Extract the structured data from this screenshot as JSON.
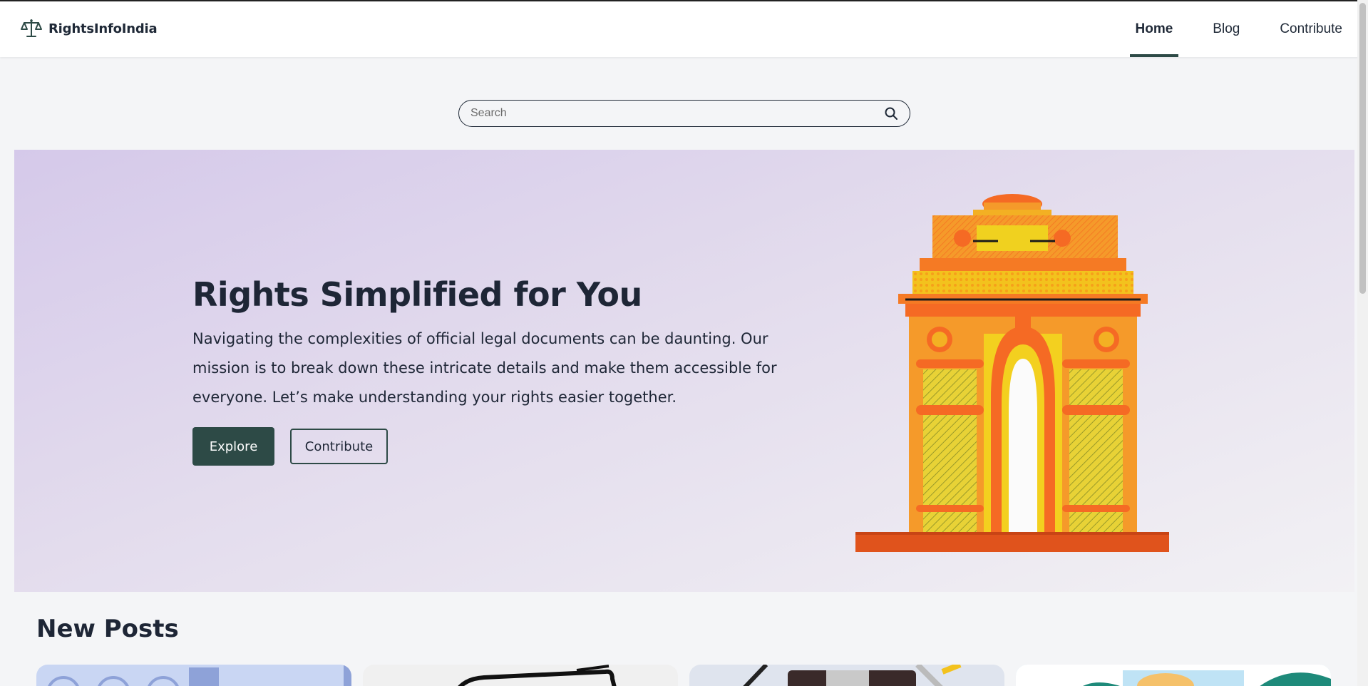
{
  "site": {
    "name": "RightsInfoIndia",
    "logo_icon": "scales-icon"
  },
  "nav": {
    "items": [
      {
        "label": "Home",
        "active": true
      },
      {
        "label": "Blog",
        "active": false
      },
      {
        "label": "Contribute",
        "active": false
      }
    ]
  },
  "search": {
    "placeholder": "Search",
    "value": "",
    "icon": "search-icon"
  },
  "hero": {
    "title": "Rights Simplified for You",
    "description": "Navigating the complexities of official legal documents can be daunting. Our mission is to break down these intricate details and make them accessible for everyone. Let’s make understanding your rights easier together.",
    "primary_button": "Explore",
    "secondary_button": "Contribute",
    "illustration": "india-gate-illustration"
  },
  "new_posts": {
    "title": "New Posts",
    "cards": [
      {
        "thumbnail": "post-thumbnail-1"
      },
      {
        "thumbnail": "post-thumbnail-2"
      },
      {
        "thumbnail": "post-thumbnail-3"
      },
      {
        "thumbnail": "post-thumbnail-4"
      }
    ]
  },
  "colors": {
    "accent": "#2d4a46",
    "text": "#1e2636",
    "hero_gradient_start": "#d5c9ea",
    "hero_gradient_end": "#f2f1f4",
    "page_bg": "#f4f5f7"
  }
}
